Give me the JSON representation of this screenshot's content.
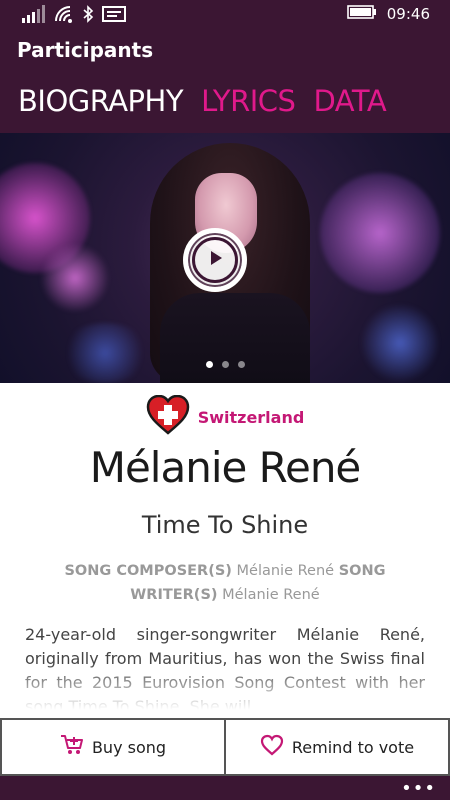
{
  "status": {
    "time": "09:46",
    "icons": [
      "signal-icon",
      "wifi-icon",
      "bluetooth-icon",
      "message-icon",
      "battery-icon"
    ]
  },
  "header": {
    "title": "Participants",
    "tabs": [
      {
        "label": "BIOGRAPHY",
        "active": true
      },
      {
        "label": "LYRICS",
        "active": false
      },
      {
        "label": "DATA",
        "active": false
      }
    ]
  },
  "media": {
    "play_icon": "play-icon",
    "slides": 3,
    "active_slide": 1
  },
  "participant": {
    "country": "Switzerland",
    "artist": "Mélanie René",
    "song": "Time To Shine",
    "credits": {
      "composer_label": "SONG COMPOSER(S)",
      "composer": "Mélanie René",
      "writer_label": "SONG WRITER(S)",
      "writer": "Mélanie René"
    },
    "bio": "24-year-old singer-songwriter Mélanie René, originally from Mauritius, has won the Swiss final for the 2015 Eurovision Song Contest with her song Time To Shine. She will"
  },
  "actions": {
    "buy_label": "Buy song",
    "remind_label": "Remind to vote"
  },
  "appbar": {
    "more_label": "•••"
  },
  "colors": {
    "header_bg": "#3b1633",
    "accent": "#e0198b",
    "country_text": "#c41875"
  }
}
